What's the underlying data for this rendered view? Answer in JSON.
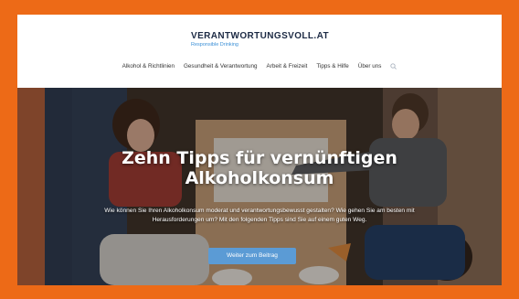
{
  "logo": {
    "main": "VERANTWORTUNGSVOLL.AT",
    "sub": "Responsible Drinking"
  },
  "nav": {
    "items": [
      {
        "label": "Alkohol & Richtlinien"
      },
      {
        "label": "Gesundheit & Verantwortung"
      },
      {
        "label": "Arbeit & Freizeit"
      },
      {
        "label": "Tipps & Hilfe"
      },
      {
        "label": "Über uns"
      }
    ]
  },
  "hero": {
    "title_line1": "Zehn Tipps für vernünftigen",
    "title_line2": "Alkoholkonsum",
    "text": "Wie können Sie Ihren Alkoholkonsum moderat und verantwortungsbewusst gestalten? Wie gehen Sie am besten mit Herausforderungen um? Mit den folgenden Tipps sind Sie auf einem guten Weg.",
    "button_label": "Weiter zum Beitrag"
  },
  "colors": {
    "frame": "#ed6a17",
    "button": "#5b9bd5",
    "logo_text": "#1c2a44",
    "logo_sub": "#3a8fd6"
  }
}
